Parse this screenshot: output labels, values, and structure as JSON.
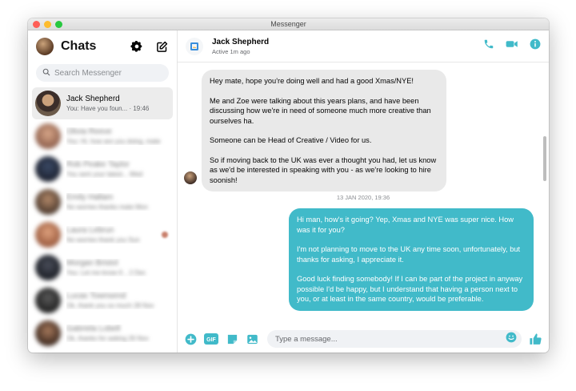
{
  "window": {
    "title": "Messenger"
  },
  "colors": {
    "accent": "#41bac9",
    "traffic": [
      "#fe5f57",
      "#febc2e",
      "#28c840"
    ]
  },
  "sidebar": {
    "title": "Chats",
    "icons": [
      "gear-icon",
      "compose-icon"
    ],
    "search_placeholder": "Search Messenger",
    "conversations": [
      {
        "name": "Jack Shepherd",
        "preview": "You: Have you foun...",
        "time": "· 19:46",
        "active": true
      },
      {
        "name": "Olivia Reeve",
        "preview": "You: Hi, how are you doing, mate",
        "time": "",
        "blurred": true
      },
      {
        "name": "Rob Peake Taylor",
        "preview": "You sent your latest...",
        "time": "Wed",
        "blurred": true
      },
      {
        "name": "Emily Hallam",
        "preview": "No worries thanks mate",
        "time": "Mon",
        "blurred": true
      },
      {
        "name": "Laura Lebrun",
        "preview": "No worries thank you",
        "time": "Sun",
        "blurred": true,
        "unread": true
      },
      {
        "name": "Morgan Bristol",
        "preview": "You: Let me know if...",
        "time": "2 Dec",
        "blurred": true
      },
      {
        "name": "Lucas Townsend",
        "preview": "Ok, thank you so much",
        "time": "28 Nov",
        "blurred": true
      },
      {
        "name": "Gabriela Lobell",
        "preview": "Ok, thanks for asking",
        "time": "26 Nov",
        "blurred": true
      }
    ]
  },
  "chat": {
    "contact_name": "Jack Shepherd",
    "status": "Active 1m ago",
    "actions": [
      "phone-icon",
      "video-icon",
      "info-icon"
    ],
    "incoming": [
      "Hey mate, hope you're doing well and had a good Xmas/NYE!",
      "Me and Zoe were talking about this years plans, and have been discussing how we're in need of someone much more creative than ourselves ha.",
      "Someone can be Head of Creative / Video for us.",
      "So if moving back to the UK was ever a thought you had, let us know as we'd be interested in speaking with you - as we're looking to hire soonish!"
    ],
    "timestamp": "13 JAN 2020, 19:36",
    "outgoing": [
      "Hi man, how's it going? Yep, Xmas and NYE was super nice. How was it for you?",
      "I'm not planning to move to the UK any time soon, unfortunately, but thanks for asking, I appreciate it.",
      "Good luck finding somebody! If I can be part of the project in anyway possible I'd be happy, but I understand that having a person next to you, or at least in the same country, would be preferable."
    ],
    "composer": {
      "placeholder": "Type a message...",
      "gif_label": "GIF",
      "icons": [
        "plus-icon",
        "gif-icon",
        "sticker-icon",
        "image-icon",
        "emoji-icon",
        "thumbs-up-icon"
      ]
    }
  }
}
